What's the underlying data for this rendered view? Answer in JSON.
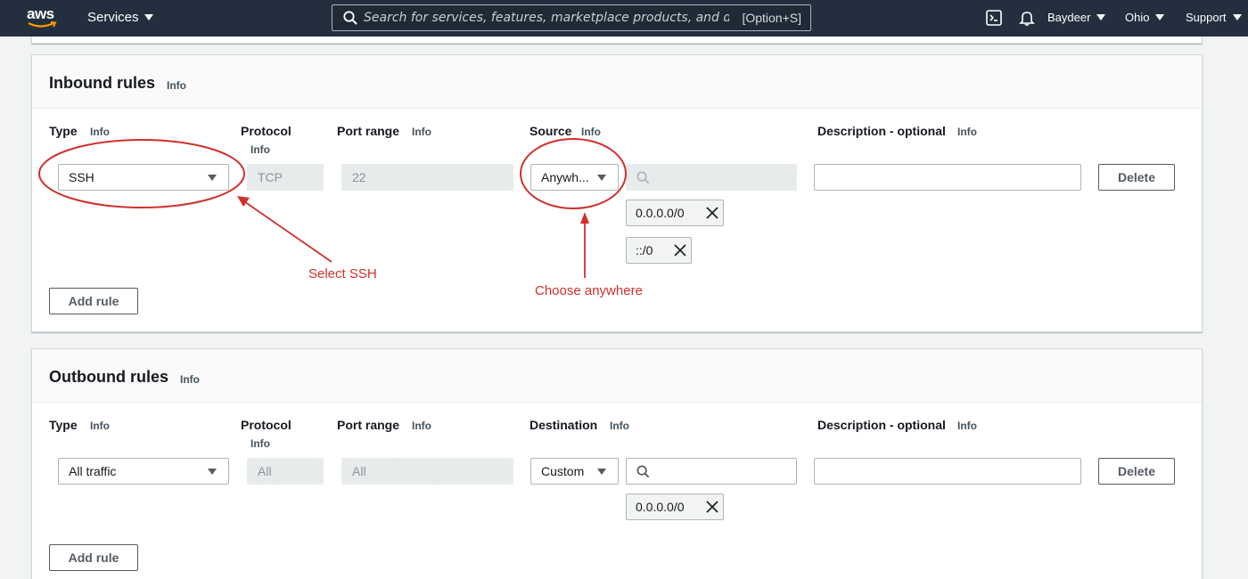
{
  "nav": {
    "logo": "aws",
    "services_label": "Services",
    "search_placeholder": "Search for services, features, marketplace products, and docs",
    "search_shortcut": "[Option+S]",
    "user_label": "Baydeer",
    "region_label": "Ohio",
    "support_label": "Support"
  },
  "inbound": {
    "title": "Inbound rules",
    "title_info": "Info",
    "columns": {
      "type": "Type",
      "type_info": "Info",
      "protocol": "Protocol",
      "protocol_info": "Info",
      "port": "Port range",
      "port_info": "Info",
      "source": "Source",
      "source_info": "Info",
      "description": "Description - optional",
      "description_info": "Info"
    },
    "row": {
      "type": "SSH",
      "protocol": "TCP",
      "port": "22",
      "source": "Anywh...",
      "source_search_value": "",
      "description": "",
      "cidrs": [
        "0.0.0.0/0",
        "::/0"
      ],
      "delete_label": "Delete"
    },
    "add_rule_label": "Add rule"
  },
  "outbound": {
    "title": "Outbound rules",
    "title_info": "Info",
    "columns": {
      "type": "Type",
      "type_info": "Info",
      "protocol": "Protocol",
      "protocol_info": "Info",
      "port": "Port range",
      "port_info": "Info",
      "destination": "Destination",
      "destination_info": "Info",
      "description": "Description - optional",
      "description_info": "Info"
    },
    "row": {
      "type": "All traffic",
      "protocol": "All",
      "port": "All",
      "destination": "Custom",
      "destination_search_value": "",
      "description": "",
      "cidrs": [
        "0.0.0.0/0"
      ],
      "delete_label": "Delete"
    },
    "add_rule_label": "Add rule"
  },
  "annotations": {
    "select_ssh": "Select SSH",
    "choose_anywhere": "Choose anywhere",
    "color": "#d0302c"
  },
  "colors": {
    "nav_bg": "#232f3e",
    "page_bg": "#f2f3f3",
    "annotation": "#d0302c"
  }
}
